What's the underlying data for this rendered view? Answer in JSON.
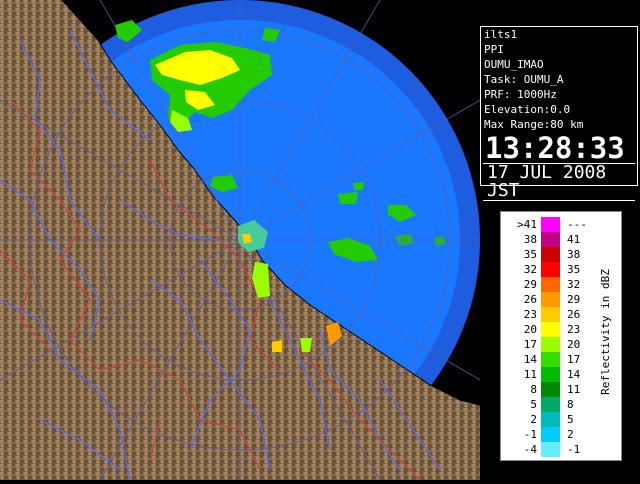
{
  "info": {
    "lines": [
      "ilts1",
      "PPI",
      "OUMU_IMAO",
      "Task: OUMU_A",
      "PRF: 1000Hz",
      "Elevation:0.0",
      "Max Range:80 km"
    ],
    "time": "13:28:33",
    "date": "17 JUL 2008 JST"
  },
  "legend": {
    "unit_label": "Reflectivity in dBZ",
    "rows": [
      {
        "lo": ">41",
        "hi": "---",
        "color": "#ff00ff"
      },
      {
        "lo": "38",
        "hi": "41",
        "color": "#c00080"
      },
      {
        "lo": "35",
        "hi": "38",
        "color": "#cc0000"
      },
      {
        "lo": "32",
        "hi": "35",
        "color": "#ff0000"
      },
      {
        "lo": "29",
        "hi": "32",
        "color": "#ff6600"
      },
      {
        "lo": "26",
        "hi": "29",
        "color": "#ff9900"
      },
      {
        "lo": "23",
        "hi": "26",
        "color": "#ffcc00"
      },
      {
        "lo": "20",
        "hi": "23",
        "color": "#ffff00"
      },
      {
        "lo": "17",
        "hi": "20",
        "color": "#99ff00"
      },
      {
        "lo": "14",
        "hi": "17",
        "color": "#33dd00"
      },
      {
        "lo": "11",
        "hi": "14",
        "color": "#00bb00"
      },
      {
        "lo": "8",
        "hi": "11",
        "color": "#008800"
      },
      {
        "lo": "5",
        "hi": "8",
        "color": "#00aa66"
      },
      {
        "lo": "2",
        "hi": "5",
        "color": "#00bbbb"
      },
      {
        "lo": "-1",
        "hi": "2",
        "color": "#00ccff"
      },
      {
        "lo": "-4",
        "hi": "-1",
        "color": "#66eeff"
      }
    ]
  },
  "colors": {
    "sea_outer": "#1e5de0",
    "sea_inner": "#1a78ff",
    "land": "#8a6e4a",
    "rivers": "#4f6bff",
    "borders": "#d04040",
    "range_rings": "#5a5aaa"
  }
}
